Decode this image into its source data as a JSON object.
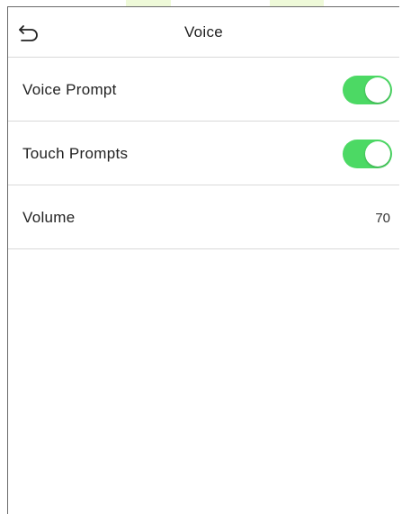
{
  "header": {
    "title": "Voice",
    "back_icon": "back-arrow-icon"
  },
  "settings": [
    {
      "label": "Voice Prompt",
      "type": "toggle",
      "enabled": true
    },
    {
      "label": "Touch Prompts",
      "type": "toggle",
      "enabled": true
    },
    {
      "label": "Volume",
      "type": "value",
      "value": "70"
    }
  ],
  "colors": {
    "toggle_on": "#4cd964",
    "divider": "#d9d9d9"
  }
}
